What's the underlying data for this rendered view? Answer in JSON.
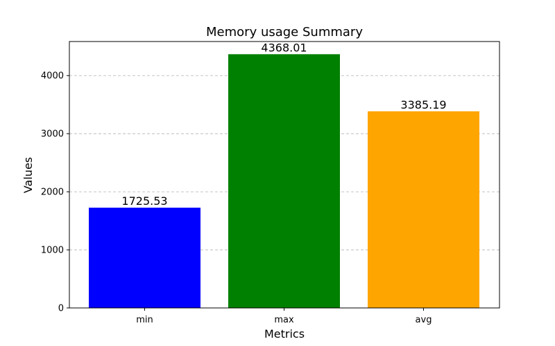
{
  "chart_data": {
    "type": "bar",
    "title": "Memory usage Summary",
    "xlabel": "Metrics",
    "ylabel": "Values",
    "categories": [
      "min",
      "max",
      "avg"
    ],
    "values": [
      1725.53,
      4368.01,
      3385.19
    ],
    "value_labels": [
      "1725.53",
      "4368.01",
      "3385.19"
    ],
    "colors": [
      "#0000ff",
      "#008000",
      "#ffa500"
    ],
    "ylim": [
      0,
      4586.41
    ],
    "yticks": [
      0,
      1000,
      2000,
      3000,
      4000
    ],
    "ytick_labels": [
      "0",
      "1000",
      "2000",
      "3000",
      "4000"
    ],
    "grid": "y-dashed",
    "legend": "none"
  }
}
